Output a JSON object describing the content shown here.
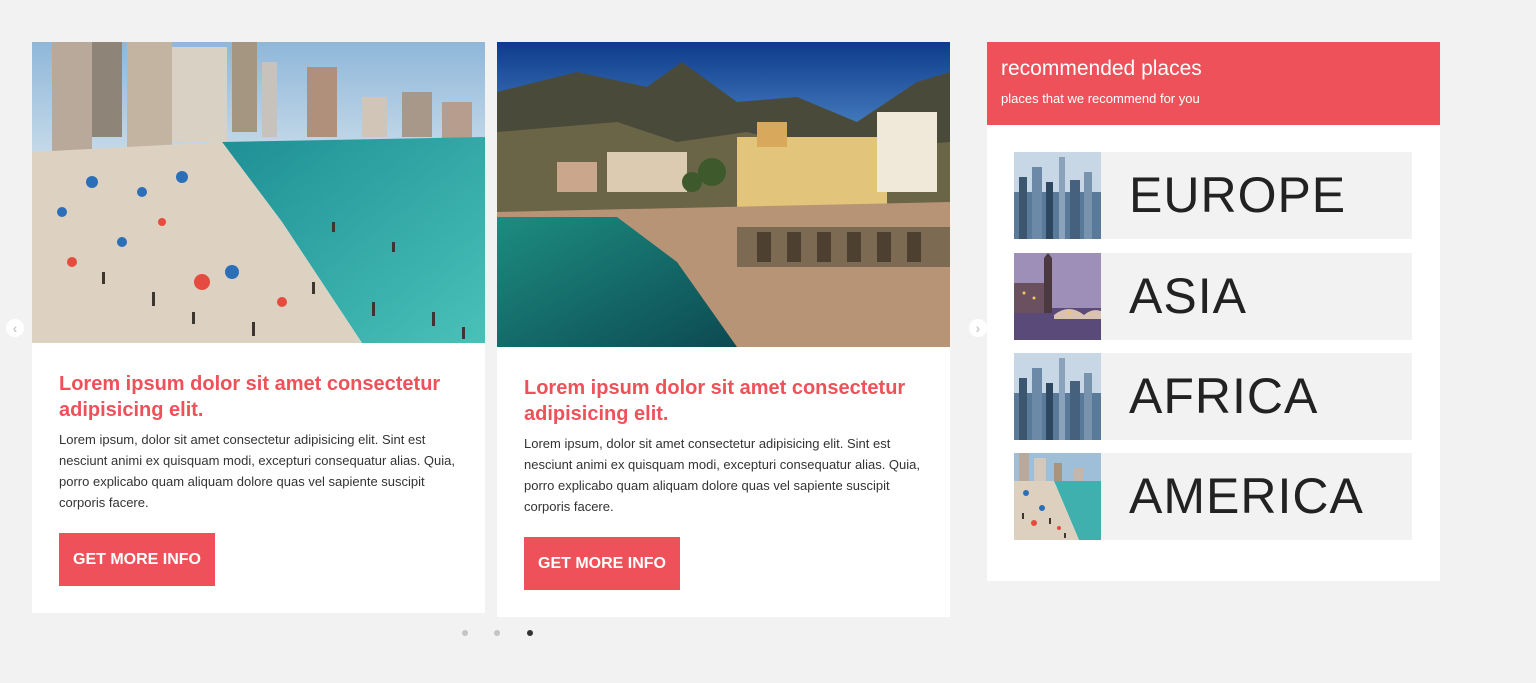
{
  "cards": [
    {
      "image": "crowded-city-beach-photo",
      "title": "Lorem ipsum dolor sit amet consectetur adipisicing elit.",
      "text": "Lorem ipsum, dolor sit amet consectetur adipisicing elit. Sint est nesciunt animi ex quisquam modi, excepturi consequatur alias. Quia, porro explicabo quam aliquam dolore quas vel sapiente suscipit corporis facere.",
      "button": "GET MORE INFO"
    },
    {
      "image": "coastal-village-beach-photo",
      "title": "Lorem ipsum dolor sit amet consectetur adipisicing elit.",
      "text": "Lorem ipsum, dolor sit amet consectetur adipisicing elit. Sint est nesciunt animi ex quisquam modi, excepturi consequatur alias. Quia, porro explicabo quam aliquam dolore quas vel sapiente suscipit corporis facere.",
      "button": "GET MORE INFO"
    }
  ],
  "carousel": {
    "prev_icon": "chevron-left-icon",
    "next_icon": "chevron-right-icon",
    "prev_glyph": "‹",
    "next_glyph": "›",
    "slide_count": 3,
    "active_slide": 3
  },
  "sidebar": {
    "title": "recommended places",
    "subtitle": "places that we recommend for you",
    "places": [
      {
        "label": "EUROPE",
        "image": "city-skyline-thumbnail"
      },
      {
        "label": "ASIA",
        "image": "bridge-at-dusk-thumbnail"
      },
      {
        "label": "AFRICA",
        "image": "city-skyline-thumbnail"
      },
      {
        "label": "AMERICA",
        "image": "beach-crowd-thumbnail"
      }
    ]
  },
  "colors": {
    "accent": "#ee5159",
    "background": "#f2f2f2",
    "card": "#ffffff",
    "place_bg": "#f2f2f2",
    "text_dark": "#222222"
  }
}
